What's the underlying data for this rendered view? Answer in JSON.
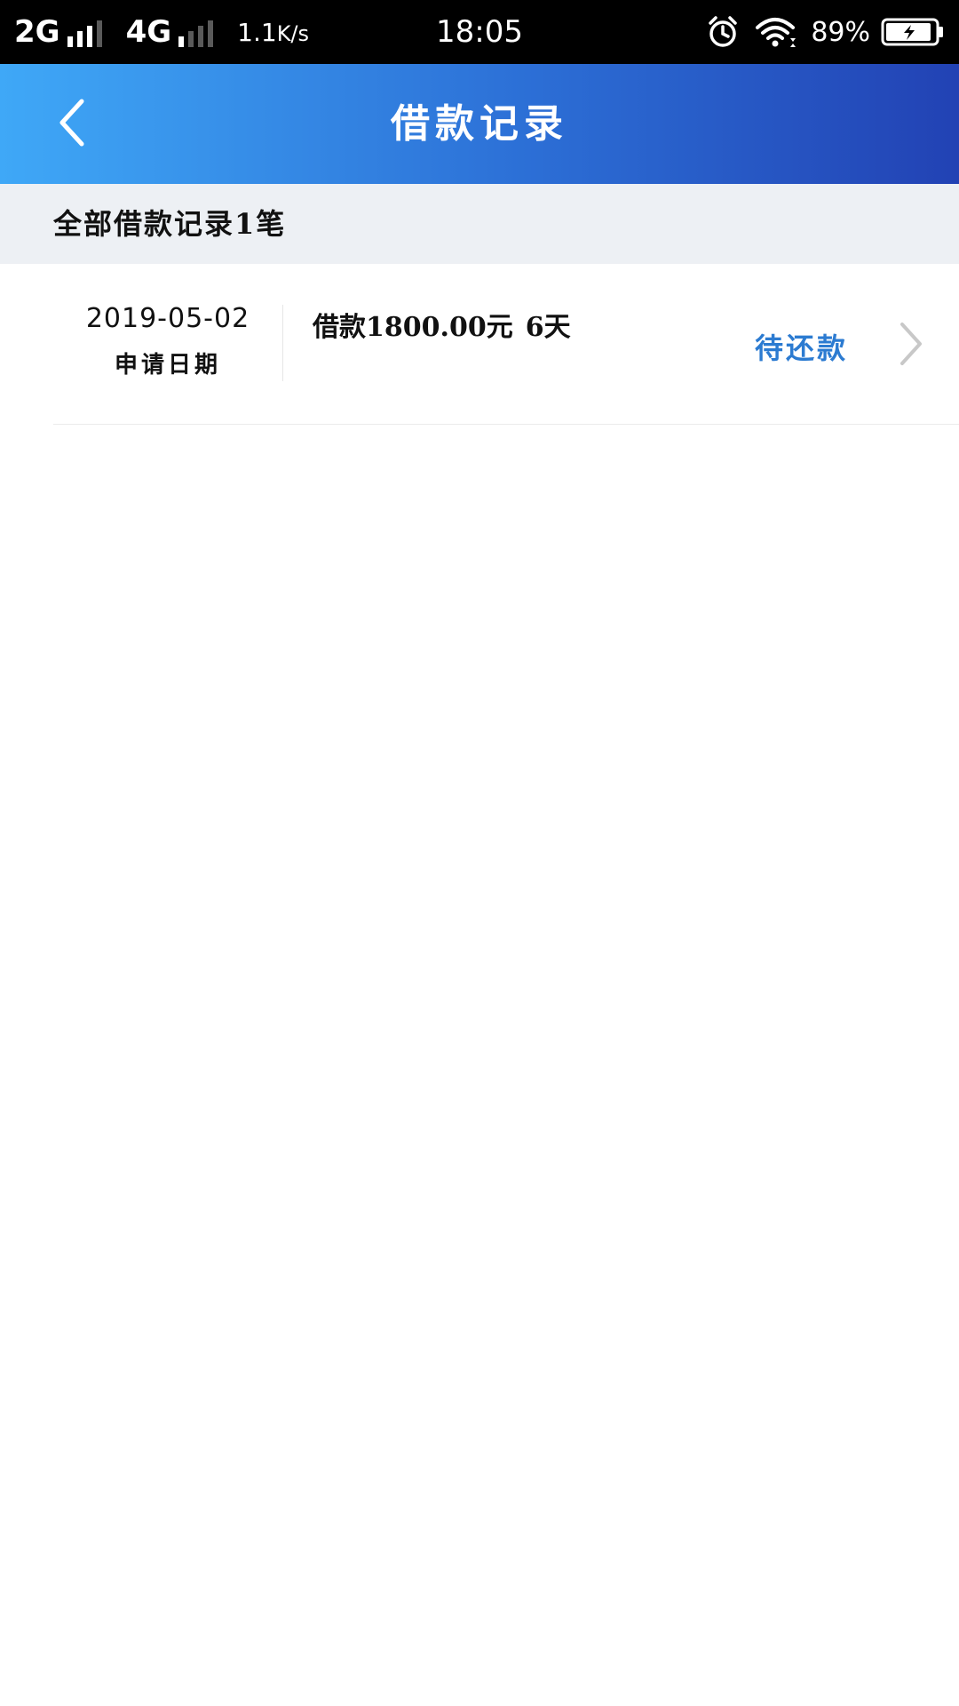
{
  "status_bar": {
    "network1": "2G",
    "network2": "4G",
    "speed_value": "1.1",
    "speed_unit": "K/s",
    "time": "18:05",
    "battery_percent": "89%",
    "icons": [
      "signal-icon",
      "alarm-icon",
      "wifi-icon",
      "battery-charging-icon"
    ]
  },
  "header": {
    "title": "借款记录",
    "back_icon": "back-chevron-icon"
  },
  "summary": {
    "text": "全部借款记录1笔"
  },
  "records": [
    {
      "date": "2019-05-02",
      "date_label": "申请日期",
      "loan_prefix": "借款",
      "amount": "1800.00",
      "currency": "元",
      "term": "6天",
      "status": "待还款",
      "chevron_icon": "chevron-right-icon"
    }
  ],
  "colors": {
    "header_gradient_start": "#3fa8f7",
    "header_gradient_end": "#2242b4",
    "summary_band": "#edf0f4",
    "status_accent": "#2c7bd1"
  }
}
